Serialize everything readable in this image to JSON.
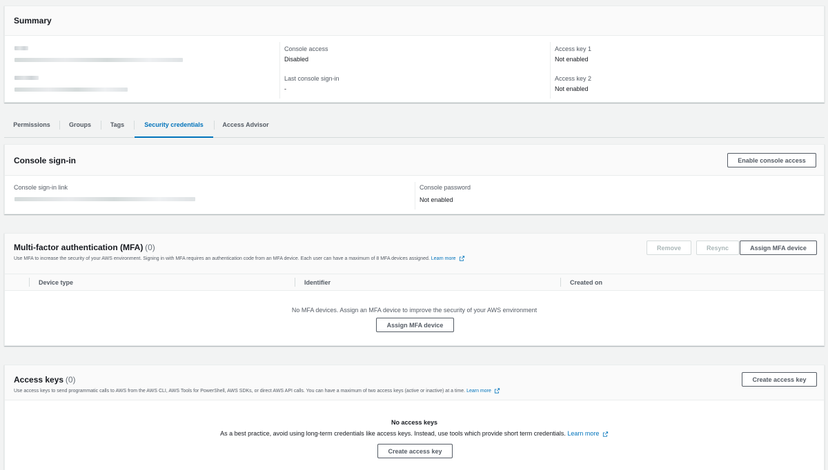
{
  "summary": {
    "title": "Summary",
    "console_access": {
      "label": "Console access",
      "value": "Disabled"
    },
    "last_signin": {
      "label": "Last console sign-in",
      "value": "-"
    },
    "access_key_1": {
      "label": "Access key 1",
      "value": "Not enabled"
    },
    "access_key_2": {
      "label": "Access key 2",
      "value": "Not enabled"
    }
  },
  "tabs": [
    {
      "label": "Permissions"
    },
    {
      "label": "Groups"
    },
    {
      "label": "Tags"
    },
    {
      "label": "Security credentials"
    },
    {
      "label": "Access Advisor"
    }
  ],
  "active_tab": "Security credentials",
  "console_signin": {
    "title": "Console sign-in",
    "enable_button": "Enable console access",
    "link_label": "Console sign-in link",
    "password_label": "Console password",
    "password_value": "Not enabled"
  },
  "mfa": {
    "title": "Multi-factor authentication (MFA)",
    "count": "(0)",
    "description": "Use MFA to increase the security of your AWS environment. Signing in with MFA requires an authentication code from an MFA device. Each user can have a maximum of 8 MFA devices assigned.",
    "learn_more": "Learn more",
    "remove_button": "Remove",
    "resync_button": "Resync",
    "assign_button": "Assign MFA device",
    "columns": [
      "Device type",
      "Identifier",
      "Created on"
    ],
    "empty_text": "No MFA devices. Assign an MFA device to improve the security of your AWS environment",
    "empty_button": "Assign MFA device"
  },
  "access_keys": {
    "title": "Access keys",
    "count": "(0)",
    "description": "Use access keys to send programmatic calls to AWS from the AWS CLI, AWS Tools for PowerShell, AWS SDKs, or direct AWS API calls. You can have a maximum of two access keys (active or inactive) at a time.",
    "learn_more": "Learn more",
    "create_button": "Create access key",
    "empty_title": "No access keys",
    "empty_text": "As a best practice, avoid using long-term credentials like access keys. Instead, use tools which provide short term credentials.",
    "empty_learn_more": "Learn more",
    "empty_button": "Create access key"
  },
  "colors": {
    "link": "#0073bb",
    "text": "#16191f",
    "muted": "#545b64",
    "background": "#f2f3f3"
  }
}
